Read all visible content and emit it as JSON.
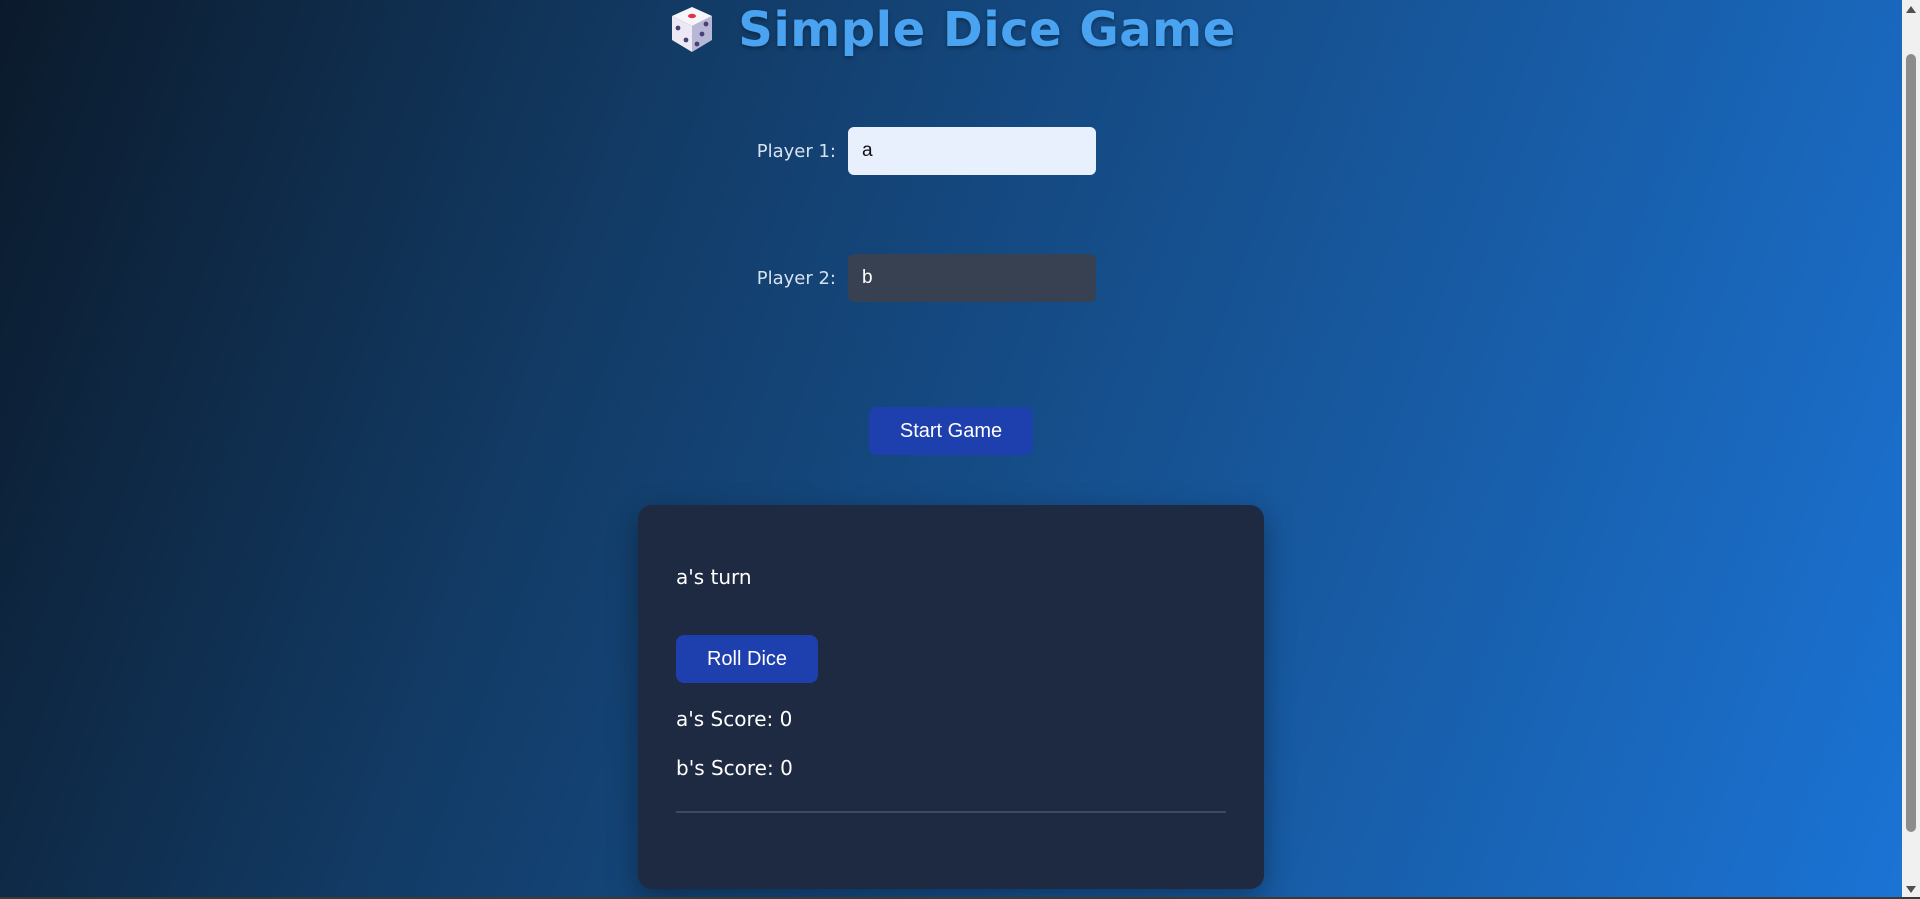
{
  "header": {
    "icon": "dice-icon",
    "title": "Simple Dice Game"
  },
  "form": {
    "player1_label": "Player 1:",
    "player1_value": "a",
    "player2_label": "Player 2:",
    "player2_value": "b",
    "start_label": "Start Game"
  },
  "game": {
    "turn_text": "a's turn",
    "roll_label": "Roll Dice",
    "scores": [
      "a's Score: 0",
      "b's Score: 0"
    ]
  },
  "colors": {
    "title": "#4aa3f0",
    "button": "#1e3fae",
    "panel": "#1d2a41"
  }
}
